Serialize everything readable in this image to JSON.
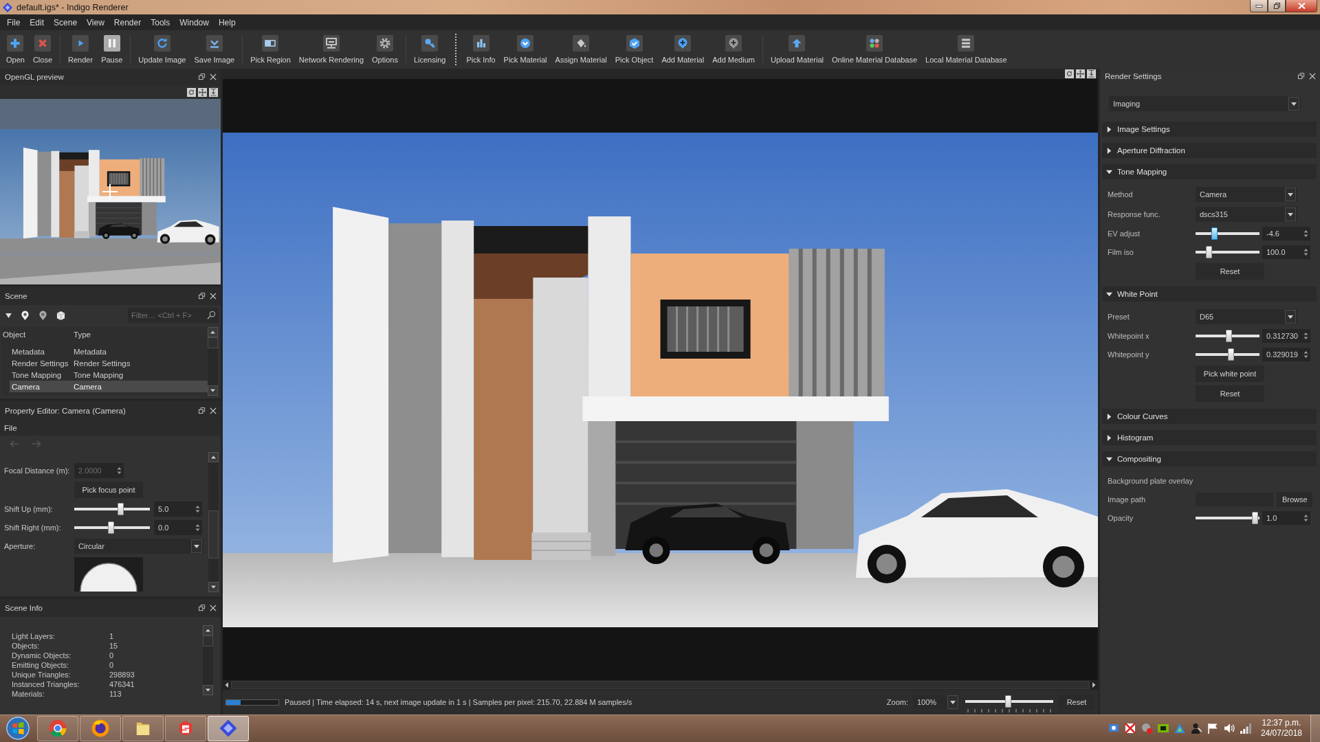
{
  "window": {
    "title": "default.igs* - Indigo Renderer"
  },
  "menu": [
    "File",
    "Edit",
    "Scene",
    "View",
    "Render",
    "Tools",
    "Window",
    "Help"
  ],
  "toolbars": [
    {
      "groups": [
        [
          {
            "label": "Open",
            "active": false
          },
          {
            "label": "Close",
            "active": false
          }
        ],
        [
          {
            "label": "Render",
            "active": false
          },
          {
            "label": "Pause",
            "active": true
          }
        ],
        [
          {
            "label": "Update Image",
            "active": false
          },
          {
            "label": "Save Image",
            "active": false
          }
        ],
        [
          {
            "label": "Pick Region",
            "active": false
          },
          {
            "label": "Network Rendering",
            "active": false
          },
          {
            "label": "Options",
            "active": false
          }
        ],
        [
          {
            "label": "Licensing",
            "active": false
          }
        ]
      ]
    },
    {
      "groups": [
        [
          {
            "label": "Pick Info",
            "active": false
          },
          {
            "label": "Pick Material",
            "active": false
          },
          {
            "label": "Assign Material",
            "active": false
          },
          {
            "label": "Pick Object",
            "active": false
          },
          {
            "label": "Add Material",
            "active": false
          },
          {
            "label": "Add Medium",
            "active": false
          }
        ],
        [
          {
            "label": "Upload Material",
            "active": false
          },
          {
            "label": "Online Material Database",
            "active": false
          },
          {
            "label": "Local Material Database",
            "active": false
          }
        ]
      ]
    }
  ],
  "opengl_preview": {
    "title": "OpenGL preview"
  },
  "scene": {
    "title": "Scene",
    "filter": {
      "placeholder": "Filter… <Ctrl + F>"
    },
    "columns": [
      "Object",
      "Type"
    ],
    "rows": [
      {
        "object": "Metadata",
        "type": "Metadata",
        "selected": false
      },
      {
        "object": "Render Settings",
        "type": "Render Settings",
        "selected": false
      },
      {
        "object": "Tone Mapping",
        "type": "Tone Mapping",
        "selected": false
      },
      {
        "object": "Camera",
        "type": "Camera",
        "selected": true
      }
    ]
  },
  "property_editor": {
    "title": "Property Editor: Camera (Camera)",
    "menu": [
      "File"
    ],
    "back_disabled": true,
    "forward_disabled": true,
    "rows": [
      {
        "kind": "spin",
        "label": "Focal Distance (m):",
        "value": "2.0000",
        "disabled": true
      },
      {
        "kind": "button",
        "label": "Pick focus point",
        "disabled": false
      },
      {
        "kind": "slider",
        "label": "Shift Up (mm):",
        "level": 0.62,
        "value": "5.0",
        "disabled": false
      },
      {
        "kind": "slider",
        "label": "Shift Right (mm):",
        "level": 0.49,
        "value": "0.0",
        "disabled": false
      },
      {
        "kind": "dropdown",
        "label": "Aperture:",
        "value": "Circular",
        "disabled": false
      },
      {
        "kind": "aperture_preview"
      }
    ]
  },
  "scene_info": {
    "title": "Scene Info",
    "stats": [
      {
        "label": "Light Layers:",
        "value": "1"
      },
      {
        "label": "Objects:",
        "value": "15"
      },
      {
        "label": "Dynamic Objects:",
        "value": "0"
      },
      {
        "label": "Emitting Objects:",
        "value": "0"
      },
      {
        "label": "Unique Triangles:",
        "value": "298893"
      },
      {
        "label": "Instanced Triangles:",
        "value": "476341"
      },
      {
        "label": "Materials:",
        "value": "113"
      }
    ]
  },
  "status_bar": {
    "progress": {
      "level": 0.27
    },
    "message": "Paused | Time elapsed: 14 s, next image update in 1 s | Samples per pixel: 215.70, 22.884 M samples/s",
    "zoom": {
      "label": "Zoom:",
      "value": "100%",
      "slider": {
        "level": 0.49
      }
    },
    "reset": "Reset"
  },
  "render_settings": {
    "title": "Render Settings",
    "category": "Imaging",
    "sections": [
      {
        "title": "Image Settings",
        "expanded": false
      },
      {
        "title": "Aperture Diffraction",
        "expanded": false
      },
      {
        "title": "Tone Mapping",
        "expanded": true,
        "rows": [
          {
            "kind": "dropdown",
            "label": "Method",
            "value": "Camera"
          },
          {
            "kind": "dropdown",
            "label": "Response func.",
            "value": "dscs315"
          },
          {
            "kind": "slider",
            "label": "EV adjust",
            "level": 0.27,
            "value": "-4.6",
            "focused": true
          },
          {
            "kind": "slider",
            "label": "Film iso",
            "level": 0.18,
            "value": "100.0",
            "focused": false
          },
          {
            "kind": "button",
            "label": "Reset"
          }
        ]
      },
      {
        "title": "White Point",
        "expanded": true,
        "rows": [
          {
            "kind": "dropdown",
            "label": "Preset",
            "value": "D65"
          },
          {
            "kind": "slider",
            "label": "Whitepoint x",
            "level": 0.52,
            "value": "0.312730",
            "focused": false
          },
          {
            "kind": "slider",
            "label": "Whitepoint y",
            "level": 0.56,
            "value": "0.329019",
            "focused": false
          },
          {
            "kind": "button",
            "label": "Pick white point"
          },
          {
            "kind": "button",
            "label": "Reset"
          }
        ]
      },
      {
        "title": "Colour Curves",
        "expanded": false
      },
      {
        "title": "Histogram",
        "expanded": false
      },
      {
        "title": "Compositing",
        "expanded": true,
        "rows": [
          {
            "kind": "note",
            "label": "Background plate overlay"
          },
          {
            "kind": "file",
            "label": "Image path",
            "button": "Browse"
          },
          {
            "kind": "slider",
            "label": "Opacity",
            "level": 0.98,
            "value": "1.0",
            "focused": false
          }
        ]
      }
    ]
  },
  "taskbar": {
    "apps": [
      {
        "selected": false
      },
      {
        "selected": false
      },
      {
        "selected": false
      },
      {
        "selected": false
      },
      {
        "selected": true
      }
    ],
    "clock": {
      "time": "12:37 p.m.",
      "date": "24/07/2018"
    }
  }
}
